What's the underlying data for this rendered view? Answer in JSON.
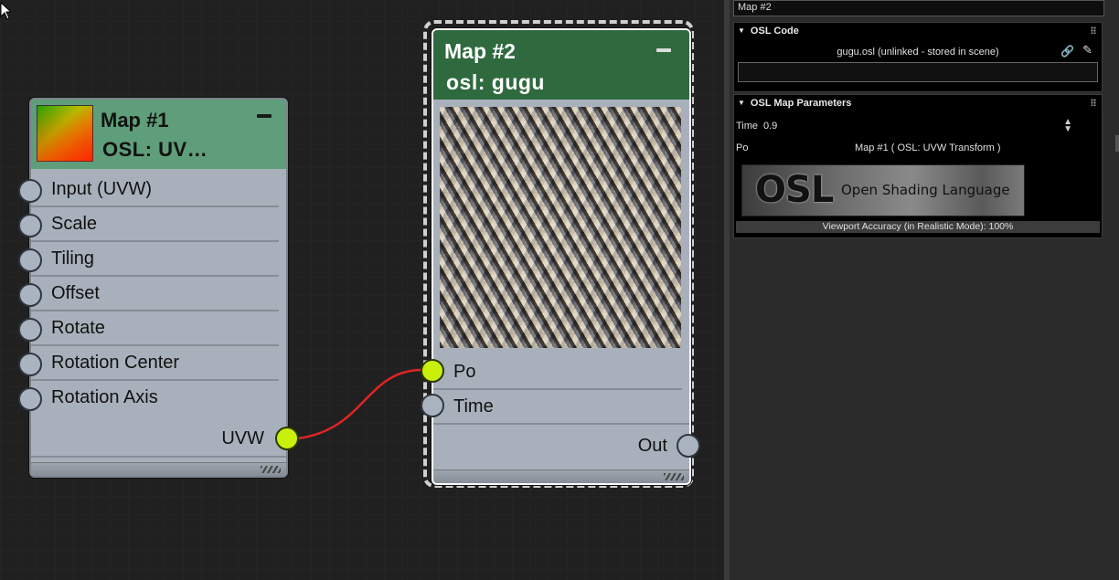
{
  "node1": {
    "title": "Map #1",
    "subtitle": "OSL: UV…",
    "inputs": [
      "Input (UVW)",
      "Scale",
      "Tiling",
      "Offset",
      "Rotate",
      "Rotation Center",
      "Rotation Axis"
    ],
    "output": "UVW"
  },
  "node2": {
    "title": "Map #2",
    "subtitle": "osl: gugu",
    "inputs": [
      "Po",
      "Time"
    ],
    "output": "Out"
  },
  "panel": {
    "map_name": "Map #2",
    "osl_code": {
      "title": "OSL Code",
      "file": "gugu.osl (unlinked - stored in scene)"
    },
    "params": {
      "title": "OSL Map Parameters",
      "time_label": "Time",
      "time_value": "0.9",
      "po_label": "Po",
      "po_value": "Map #1  ( OSL: UVW Transform )",
      "logo_mark": "OSL",
      "logo_text": "Open Shading Language",
      "accuracy": "Viewport Accuracy (in Realistic Mode): 100%"
    }
  },
  "colors": {
    "wire": "#e02424",
    "active_socket": "#c8f00a",
    "node2_header": "#2f6a3f",
    "node1_header": "#5f9e7a"
  }
}
